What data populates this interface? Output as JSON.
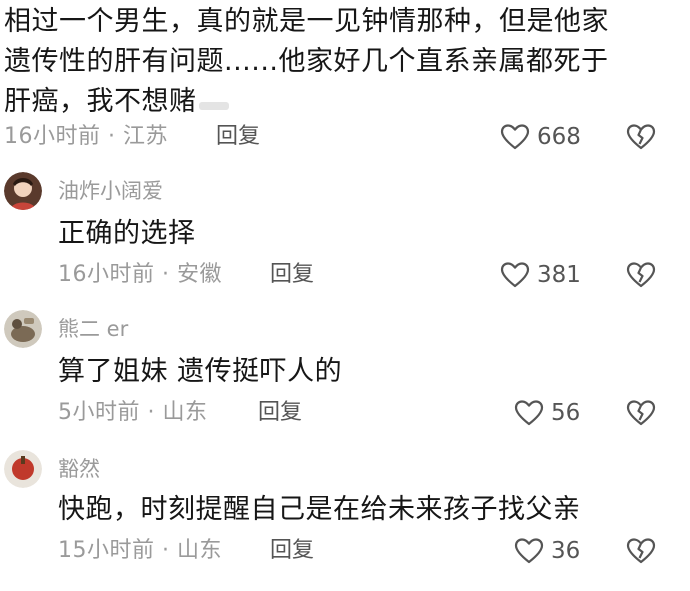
{
  "main_comment": {
    "lines": [
      "相过一个男生，真的就是一见钟情那种，但是他家",
      "遗传性的肝有问题......他家好几个直系亲属都死于",
      "肝癌，我不想赌"
    ],
    "time_location": "16小时前 · 江苏",
    "reply_label": "回复",
    "likes": "668"
  },
  "replies": [
    {
      "username": "油炸小阔爱",
      "text": "正确的选择",
      "time_location": "16小时前 · 安徽",
      "reply_label": "回复",
      "likes": "381"
    },
    {
      "username": "熊二 er",
      "text": "算了姐妹 遗传挺吓人的",
      "time_location": "5小时前 · 山东",
      "reply_label": "回复",
      "likes": "56"
    },
    {
      "username": "豁然",
      "text": "快跑，时刻提醒自己是在给未来孩子找父亲",
      "time_location": "15小时前 · 山东",
      "reply_label": "回复",
      "likes": "36"
    }
  ],
  "icons": {
    "like": "heart-outline-icon",
    "dislike": "broken-heart-icon"
  },
  "colors": {
    "meta": "#9a9a9a",
    "text": "#161616"
  }
}
